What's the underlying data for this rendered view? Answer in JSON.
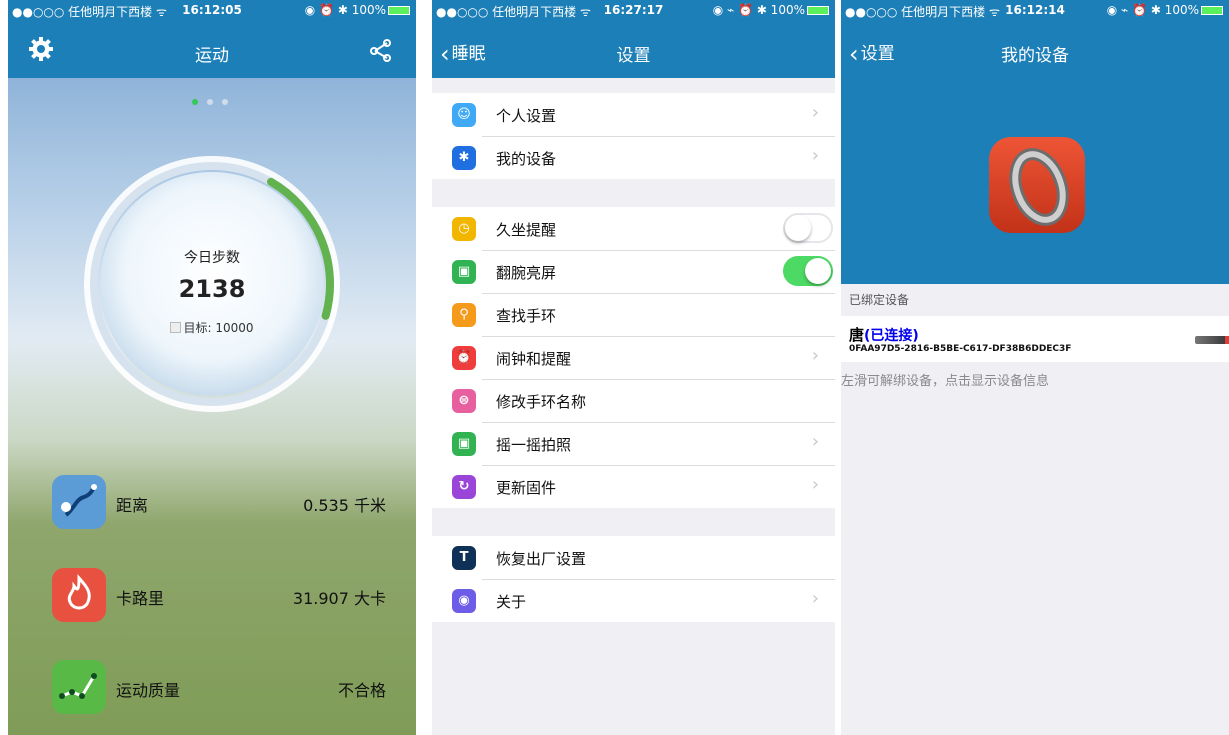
{
  "panel1": {
    "status": {
      "carrier": "●●○○○ 任他明月下西楼 ᯤ",
      "time": "16:12:05",
      "right": "◉ ⏰ ✱ 100%"
    },
    "nav": {
      "title": "运动",
      "left_icon": "gear-icon",
      "right_icon": "share-icon"
    },
    "page_dots": {
      "count": 3,
      "active": 0
    },
    "ring": {
      "label": "今日步数",
      "value": "2138",
      "goal": "目标: 10000",
      "progress_fraction": 0.21
    },
    "stats": [
      {
        "icon": "route-icon",
        "label": "距离",
        "value": "0.535 千米",
        "color": "#5b9bd6"
      },
      {
        "icon": "flame-icon",
        "label": "卡路里",
        "value": "31.907 大卡",
        "color": "#e8503f"
      },
      {
        "icon": "trend-icon",
        "label": "运动质量",
        "value": "不合格",
        "color": "#58b947"
      }
    ]
  },
  "panel2": {
    "status": {
      "carrier": "●●○○○ 任他明月下西楼 ᯤ",
      "time": "16:27:17",
      "right": "◉ ⌁ ⏰ ✱ 100%"
    },
    "nav": {
      "back": "睡眠",
      "title": "设置"
    },
    "groups": [
      [
        {
          "icon": "person-icon",
          "glyph": "☺",
          "color": "#3fa9f5",
          "label": "个人设置",
          "accessory": "chevron"
        },
        {
          "icon": "bluetooth-icon",
          "glyph": "✱",
          "color": "#1f6fe0",
          "label": "我的设备",
          "accessory": "chevron"
        }
      ],
      [
        {
          "icon": "clock-icon",
          "glyph": "◷",
          "color": "#f2b600",
          "label": "久坐提醒",
          "accessory": "toggle-off"
        },
        {
          "icon": "wrist-icon",
          "glyph": "▣",
          "color": "#31b353",
          "label": "翻腕亮屏",
          "accessory": "toggle-on"
        },
        {
          "icon": "search-icon",
          "glyph": "⚲",
          "color": "#f59a1b",
          "label": "查找手环",
          "accessory": "none"
        },
        {
          "icon": "alarm-icon",
          "glyph": "⏰",
          "color": "#ef3c3c",
          "label": "闹钟和提醒",
          "accessory": "chevron"
        },
        {
          "icon": "rename-icon",
          "glyph": "⊜",
          "color": "#e85fa0",
          "label": "修改手环名称",
          "accessory": "none"
        },
        {
          "icon": "camera-icon",
          "glyph": "▣",
          "color": "#31b353",
          "label": "摇一摇拍照",
          "accessory": "chevron"
        },
        {
          "icon": "refresh-icon",
          "glyph": "↻",
          "color": "#9b45d8",
          "label": "更新固件",
          "accessory": "chevron"
        }
      ],
      [
        {
          "icon": "hammer-icon",
          "glyph": "T",
          "color": "#0f3157",
          "label": "恢复出厂设置",
          "accessory": "none"
        },
        {
          "icon": "bulb-icon",
          "glyph": "◉",
          "color": "#6c5ce7",
          "label": "关于",
          "accessory": "chevron"
        }
      ]
    ],
    "chevron": "›"
  },
  "panel3": {
    "status": {
      "carrier": "●●○○○ 任他明月下西楼 ᯤ",
      "time": "16:12:14",
      "right": "◉ ⌁ ⏰ ✱ 100%"
    },
    "nav": {
      "back": "设置",
      "title": "我的设备"
    },
    "section_header": "已绑定设备",
    "device": {
      "name": "唐",
      "status": "(已连接)",
      "id": "0FAA97D5-2816-B5BE-C617-DF38B6DDEC3F"
    },
    "hint": "左滑可解绑设备，点击显示设备信息"
  }
}
